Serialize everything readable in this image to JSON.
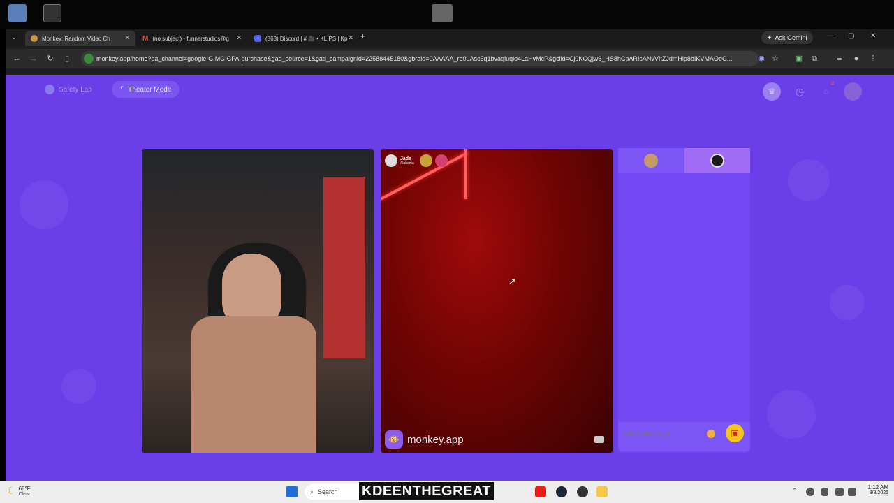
{
  "browser": {
    "tabs": [
      {
        "label": "Monkey: Random Video Ch",
        "active": true
      },
      {
        "label": "(no subject) - funnerstudios@g",
        "active": false
      },
      {
        "label": "(863) Discord | # 🎥 • KLIPS | Kp",
        "active": false
      }
    ],
    "new_tab": "+",
    "ask_gemini": "Ask Gemini",
    "url": "monkey.app/home?pa_channel=google-GIMC-CPA-purchase&gad_source=1&gad_campaignid=22588445180&gbraid=0AAAAA_re0uAsc5q1bvaqluqlo4LaHvMcP&gclid=Cj0KCQjw6_HS8hCpARIsANvVItZJdmHlp8bIKVMAOeG..."
  },
  "toolbar": {
    "safety_lab": "Safety Lab",
    "theater_mode": "Theater Mode",
    "notification_count": "3"
  },
  "remote_user": {
    "name": "Jada",
    "location": "Alabama"
  },
  "watermark": "monkey.app",
  "chat": {
    "placeholder": "Send Message"
  },
  "taskbar": {
    "temperature": "68°F",
    "weather": "Clear",
    "search": "Search",
    "time": "1:12 AM",
    "date": "8/8/2026"
  },
  "overlay_text": "KDEENTHEGREAT",
  "colors": {
    "page_bg": "#6a3fe8",
    "accent_yellow": "#f5c518",
    "chat_tab_active": "#a06cf5"
  }
}
